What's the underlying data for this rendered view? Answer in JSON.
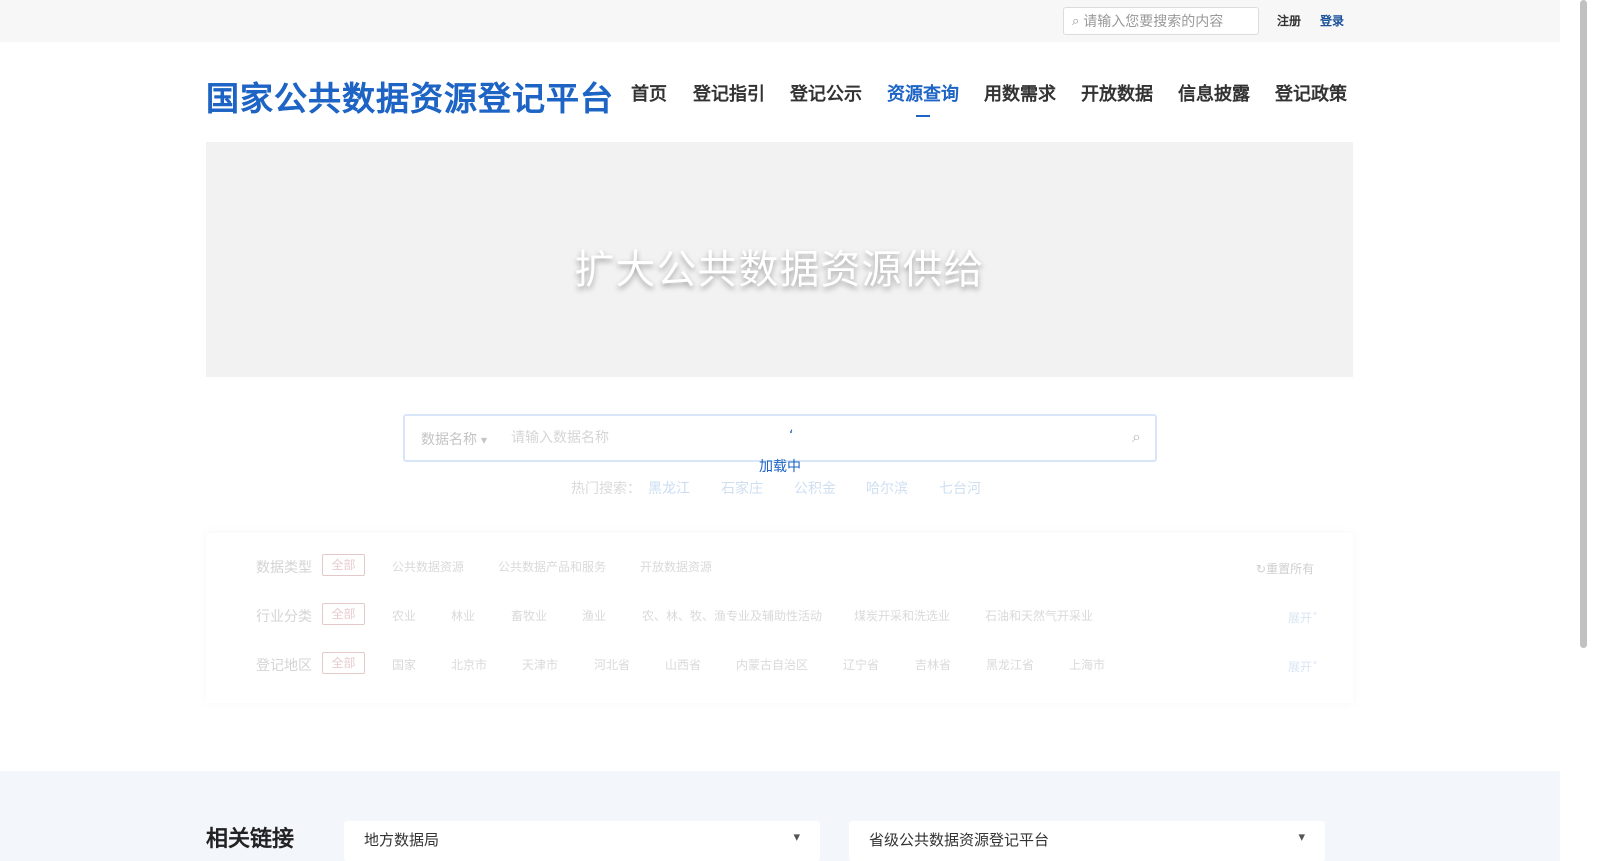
{
  "topbar": {
    "search_placeholder": "请输入您要搜索的内容",
    "register": "注册",
    "login": "登录"
  },
  "header": {
    "logo": "国家公共数据资源登记平台",
    "nav": [
      "首页",
      "登记指引",
      "登记公示",
      "资源查询",
      "用数需求",
      "开放数据",
      "信息披露",
      "登记政策"
    ],
    "active_nav": "资源查询"
  },
  "banner": {
    "title": "扩大公共数据资源供给"
  },
  "search": {
    "field_label": "数据名称",
    "placeholder": "请输入数据名称",
    "loading": "加载中",
    "hot_label": "热门搜索：",
    "hot": [
      "黑龙江",
      "石家庄",
      "公积金",
      "哈尔滨",
      "七台河"
    ]
  },
  "filters": {
    "all_label": "全部",
    "reset": "重置所有",
    "expand": "展开",
    "data_type": {
      "label": "数据类型",
      "options": [
        "公共数据资源",
        "公共数据产品和服务",
        "开放数据资源"
      ]
    },
    "industry": {
      "label": "行业分类",
      "options": [
        "农业",
        "林业",
        "畜牧业",
        "渔业",
        "农、林、牧、渔专业及辅助性活动",
        "煤炭开采和洗选业",
        "石油和天然气开采业"
      ]
    },
    "region": {
      "label": "登记地区",
      "options": [
        "国家",
        "北京市",
        "天津市",
        "河北省",
        "山西省",
        "内蒙古自治区",
        "辽宁省",
        "吉林省",
        "黑龙江省",
        "上海市"
      ]
    }
  },
  "related": {
    "title": "相关链接",
    "select1": "地方数据局",
    "select2": "省级公共数据资源登记平台"
  },
  "colors": {
    "brand": "#1d64c4",
    "accent_bg": "#f3f7fc"
  }
}
